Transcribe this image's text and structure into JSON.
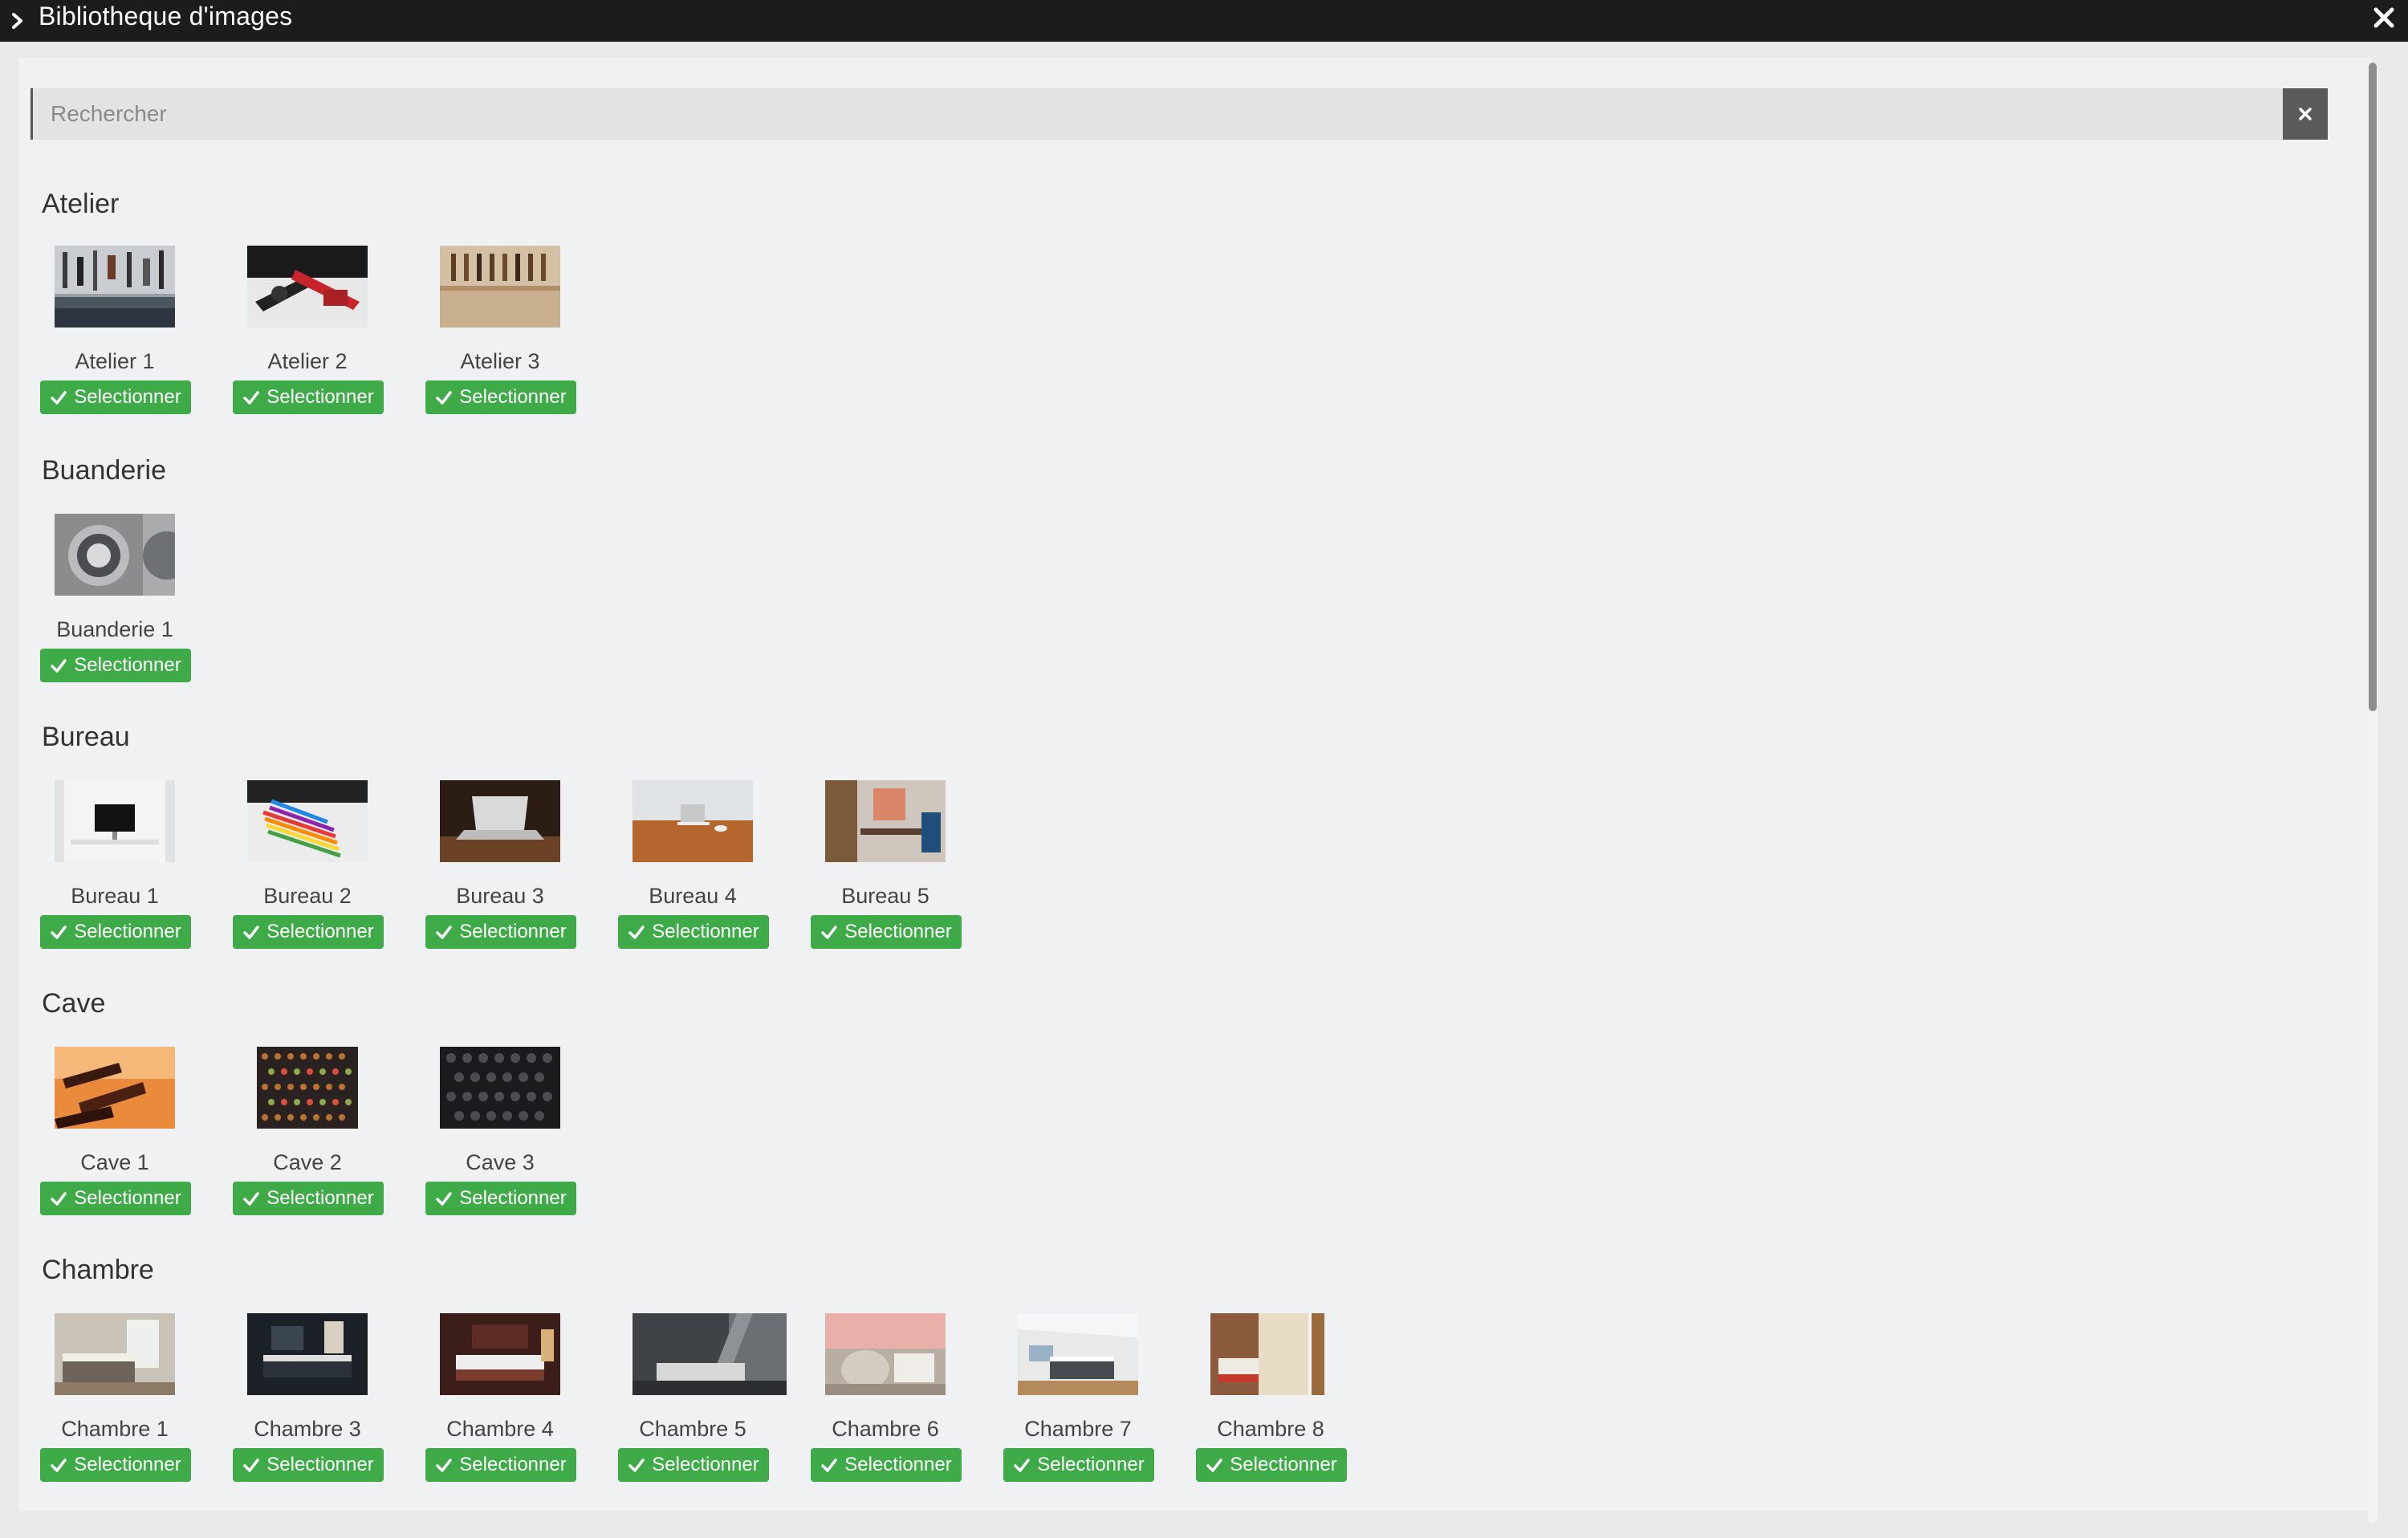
{
  "window": {
    "title": "Bibliotheque d'images"
  },
  "search": {
    "placeholder": "Rechercher",
    "value": ""
  },
  "button_label": "Selectionner",
  "colors": {
    "titlebar": "#1c1c1c",
    "select_button": "#3eaa48",
    "clear_button": "#5a5a5a"
  },
  "icons": {
    "title_toggle": "chevron-right-icon",
    "close": "close-icon",
    "search_clear": "close-icon",
    "button": "check-icon"
  },
  "sections": [
    {
      "title": "Atelier",
      "items": [
        {
          "label": "Atelier 1"
        },
        {
          "label": "Atelier 2"
        },
        {
          "label": "Atelier 3"
        }
      ]
    },
    {
      "title": "Buanderie",
      "items": [
        {
          "label": "Buanderie 1"
        }
      ]
    },
    {
      "title": "Bureau",
      "items": [
        {
          "label": "Bureau 1"
        },
        {
          "label": "Bureau 2"
        },
        {
          "label": "Bureau 3"
        },
        {
          "label": "Bureau 4"
        },
        {
          "label": "Bureau 5"
        }
      ]
    },
    {
      "title": "Cave",
      "items": [
        {
          "label": "Cave 1"
        },
        {
          "label": "Cave 2"
        },
        {
          "label": "Cave 3"
        }
      ]
    },
    {
      "title": "Chambre",
      "items": [
        {
          "label": "Chambre 1"
        },
        {
          "label": "Chambre 3"
        },
        {
          "label": "Chambre 4"
        },
        {
          "label": "Chambre 5"
        },
        {
          "label": "Chambre 6"
        },
        {
          "label": "Chambre 7"
        },
        {
          "label": "Chambre 8"
        }
      ]
    }
  ]
}
